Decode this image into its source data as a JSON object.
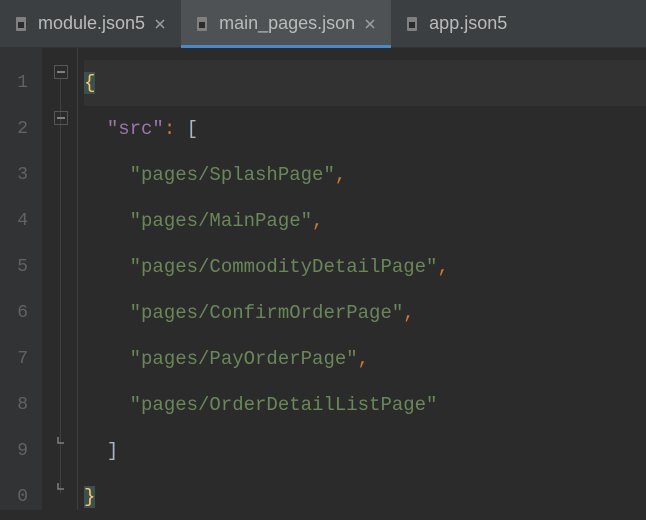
{
  "tabs": [
    {
      "label": "module.json5",
      "active": false
    },
    {
      "label": "main_pages.json",
      "active": true
    },
    {
      "label": "app.json5",
      "active": false
    }
  ],
  "lineNumbers": [
    "1",
    "2",
    "3",
    "4",
    "5",
    "6",
    "7",
    "8",
    "9",
    "0"
  ],
  "code": {
    "key": "\"src\"",
    "strings": [
      "\"pages/SplashPage\"",
      "\"pages/MainPage\"",
      "\"pages/CommodityDetailPage\"",
      "\"pages/ConfirmOrderPage\"",
      "\"pages/PayOrderPage\"",
      "\"pages/OrderDetailListPage\""
    ]
  }
}
